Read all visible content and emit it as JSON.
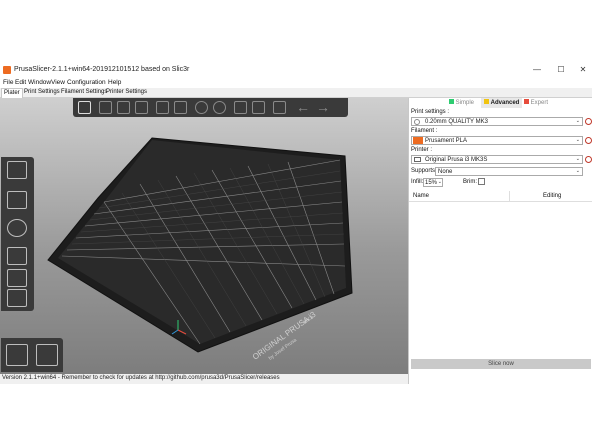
{
  "window": {
    "title": "PrusaSlicer-2.1.1+win64-201912101512 based on Slic3r",
    "controls": {
      "minimize": "—",
      "maximize": "☐",
      "close": "✕"
    }
  },
  "menu": [
    "File",
    "Edit",
    "Window",
    "View",
    "Configuration",
    "Help"
  ],
  "tabs": [
    "Plater",
    "Print Settings",
    "Filament Settings",
    "Printer Settings"
  ],
  "sidebar": {
    "modes": [
      "Simple",
      "Advanced",
      "Expert"
    ],
    "print_settings_label": "Print settings :",
    "print_settings_value": "0.20mm QUALITY MK3",
    "filament_label": "Filament :",
    "filament_value": "Prusament PLA",
    "filament_color": "#ed6b21",
    "printer_label": "Printer :",
    "printer_value": "Original Prusa i3 MK3S",
    "supports_label": "Supports:",
    "supports_value": "None",
    "infill_label": "Infill:",
    "infill_value": "15%",
    "brim_label": "Brim:",
    "columns": [
      "Name",
      "Editing"
    ],
    "slice_button": "Slice now"
  },
  "bed": {
    "logo_line1": "ORIGINAL PRUSA i3",
    "logo_line2": "MK3",
    "logo_line3": "by Josef Prusa"
  },
  "status": "Version 2.1.1+win64 - Remember to check for updates at http://github.com/prusa3d/PrusaSlicer/releases",
  "colors": {
    "mode_simple": "#2ecc71",
    "mode_advanced": "#f1c40f",
    "mode_expert": "#e74c3c",
    "accent": "#ed6b21"
  },
  "icons": [
    "add-object-icon",
    "delete-icon",
    "delete-all-icon",
    "arrange-icon",
    "copy-icon",
    "paste-icon",
    "add-instance-icon",
    "remove-instance-icon",
    "split-objects-icon",
    "split-parts-icon",
    "layer-editing-icon",
    "undo-icon",
    "redo-icon",
    "move-icon",
    "scale-icon",
    "rotate-icon",
    "place-on-face-icon",
    "cut-icon",
    "sla-support-icon",
    "iso-view-icon",
    "layers-view-icon"
  ]
}
